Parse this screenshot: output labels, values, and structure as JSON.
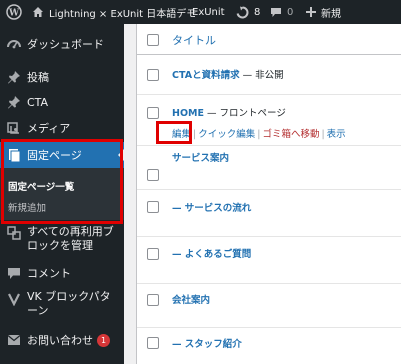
{
  "admin_bar": {
    "site_name": "Lightning × ExUnit 日本語デモ",
    "plugin_label": "ExUnit",
    "updates_count": "8",
    "comments_count": "0",
    "new_label": "新規"
  },
  "sidebar": {
    "items": [
      {
        "label": "ダッシュボード",
        "icon": "dashboard-icon"
      },
      {
        "label": "投稿",
        "icon": "pushpin-icon"
      },
      {
        "label": "CTA",
        "icon": "pushpin-icon"
      },
      {
        "label": "メディア",
        "icon": "media-icon"
      },
      {
        "label": "固定ページ",
        "icon": "page-icon"
      },
      {
        "label": "すべての再利用ブロックを管理",
        "icon": "reusable-block-icon"
      },
      {
        "label": "コメント",
        "icon": "comment-icon"
      },
      {
        "label": "VK ブロックパターン",
        "icon": "block-pattern-icon"
      },
      {
        "label": "お問い合わせ",
        "icon": "mail-icon",
        "badge": "1"
      }
    ],
    "submenu": [
      {
        "label": "固定ページ一覧"
      },
      {
        "label": "新規追加"
      }
    ]
  },
  "table": {
    "header_title": "タイトル",
    "rows": [
      {
        "title": "CTAと資料請求",
        "state": " — 非公開"
      },
      {
        "title": "HOME",
        "state": " — フロントページ"
      },
      {
        "title": "サービス案内",
        "state": ""
      },
      {
        "title": "— サービスの流れ",
        "state": ""
      },
      {
        "title": "— よくあるご質問",
        "state": ""
      },
      {
        "title": "会社案内",
        "state": ""
      },
      {
        "title": "— スタッフ紹介",
        "state": ""
      }
    ],
    "row_actions": {
      "edit": "編集",
      "quick_edit": "クイック編集",
      "trash": "ゴミ箱へ移動",
      "view": "表示",
      "separator": "|"
    }
  },
  "colors": {
    "admin_dark": "#1d2327",
    "accent_blue": "#2271b1",
    "highlight_red": "#e00000",
    "badge_red": "#d63638",
    "trash_red": "#b32d2e"
  }
}
